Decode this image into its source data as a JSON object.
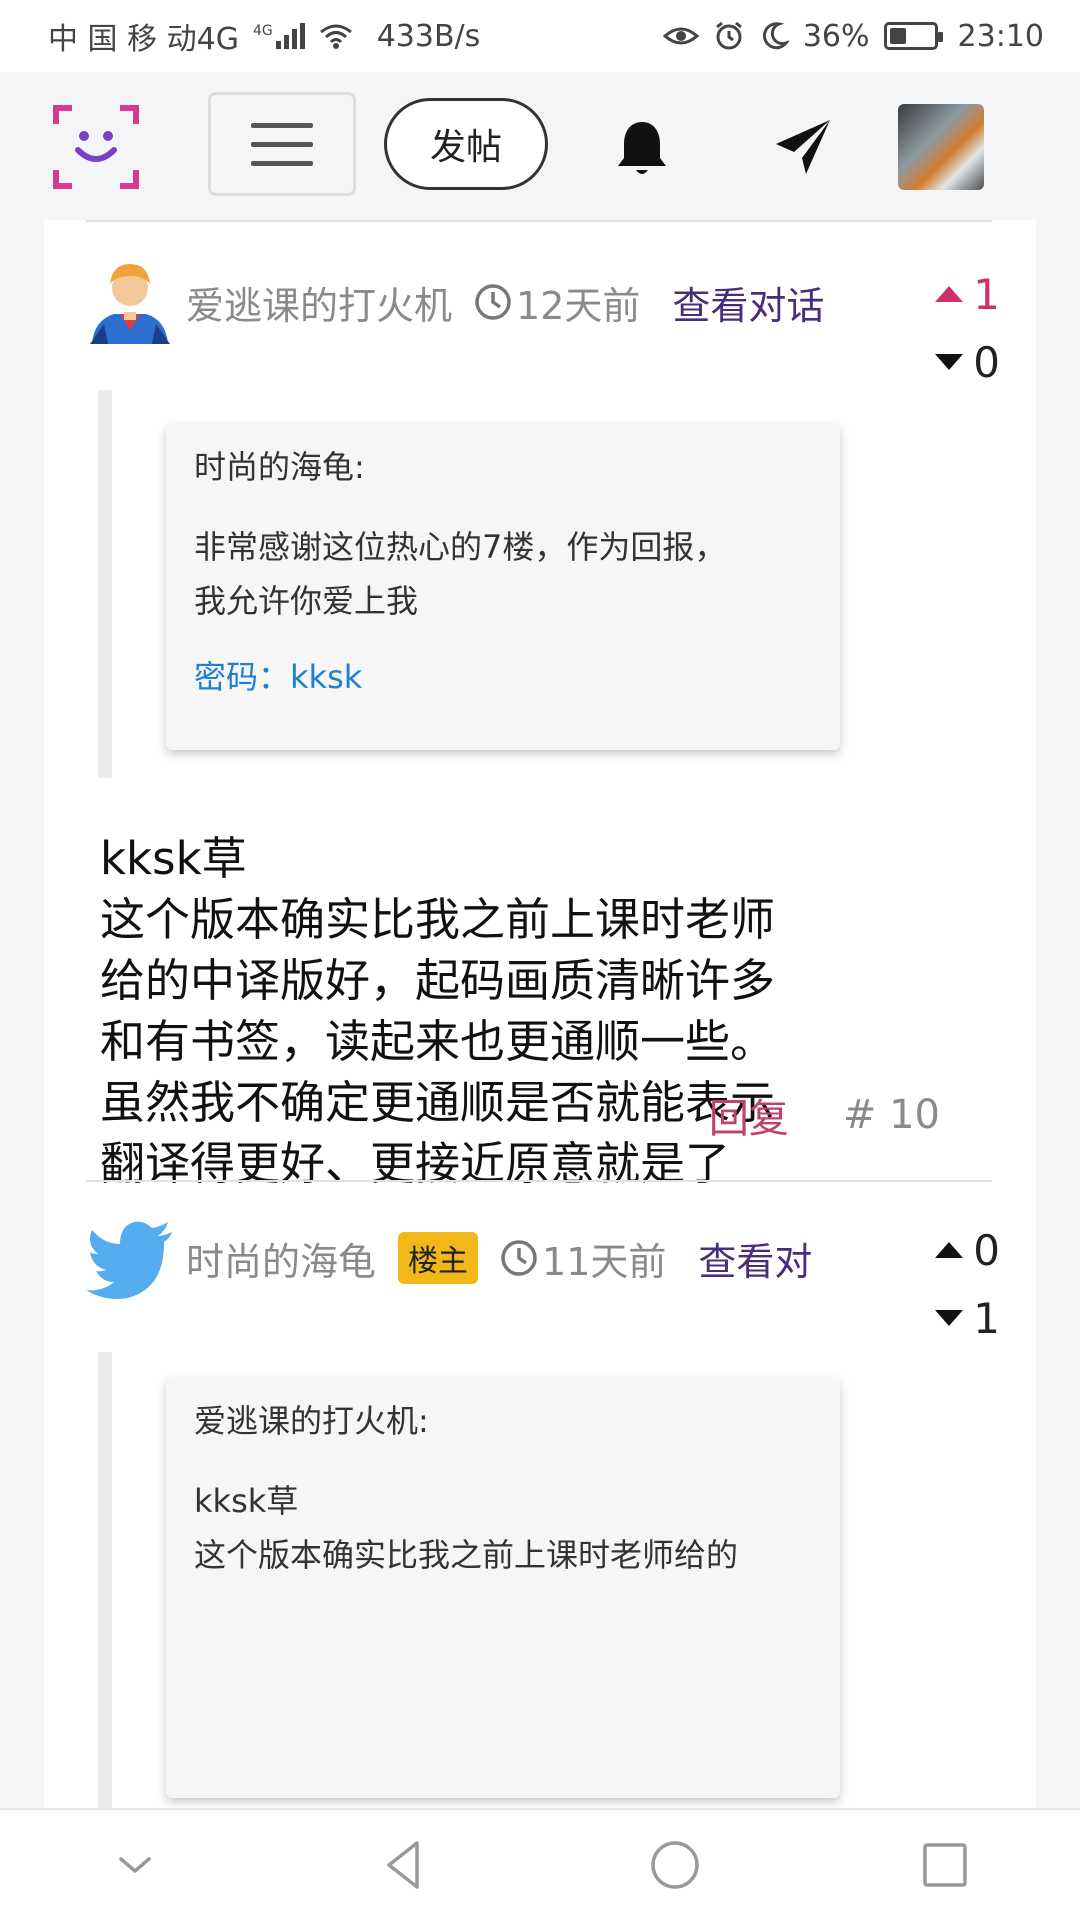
{
  "status_bar": {
    "carrier": "中 国 移 动4G",
    "net_badge": "4G",
    "speed": "433B/s",
    "battery_pct": "36%",
    "battery_level": 0.36,
    "time": "23:10"
  },
  "header": {
    "post_label": "发帖"
  },
  "posts": [
    {
      "author": "爱逃课的打火机",
      "time": "12天前",
      "convo": "查看对话",
      "upvotes": "1",
      "downvotes": "0",
      "quote": {
        "author": "时尚的海龟:",
        "text_line1": "非常感谢这位热心的7楼，作为回报，",
        "text_line2": "我允许你爱上我",
        "password": "密码：kksk"
      },
      "body": [
        "kksk草",
        "这个版本确实比我之前上课时老师",
        "给的中译版好，起码画质清晰许多",
        "和有书签，读起来也更通顺一些。",
        "虽然我不确定更通顺是否就能表示",
        "翻译得更好、更接近原意就是了"
      ],
      "reply_label": "回复",
      "floor": "# 10"
    },
    {
      "author": "时尚的海龟",
      "badge": "楼主",
      "time": "11天前",
      "convo": "查看对",
      "upvotes": "0",
      "downvotes": "1",
      "quote": {
        "author": "爱逃课的打火机:",
        "text_line1": "kksk草",
        "text_line2": "这个版本确实比我之前上课时老师给的"
      }
    }
  ],
  "colors": {
    "accent_vote": "#d0306a",
    "convo_link": "#4a2c7a",
    "password_link": "#1e7fd6",
    "reply_link": "#c0406e",
    "owner_badge": "#f2b718"
  }
}
